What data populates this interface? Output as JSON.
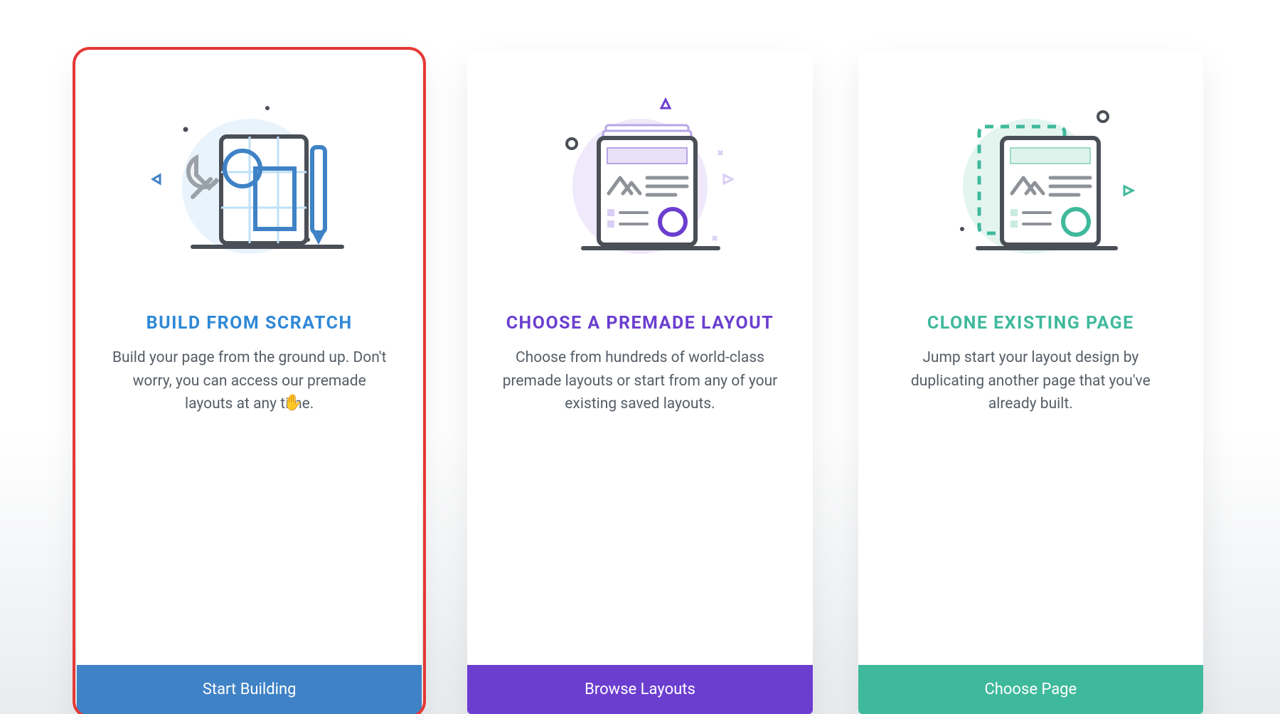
{
  "cards": [
    {
      "title": "BUILD FROM SCRATCH",
      "desc": "Build your page from the ground up. Don't worry, you can access our premade layouts at any time.",
      "button": "Start Building"
    },
    {
      "title": "CHOOSE A PREMADE LAYOUT",
      "desc": "Choose from hundreds of world-class premade layouts or start from any of your existing saved layouts.",
      "button": "Browse Layouts"
    },
    {
      "title": "CLONE EXISTING PAGE",
      "desc": "Jump start your layout design by duplicating another page that you've already built.",
      "button": "Choose Page"
    }
  ]
}
